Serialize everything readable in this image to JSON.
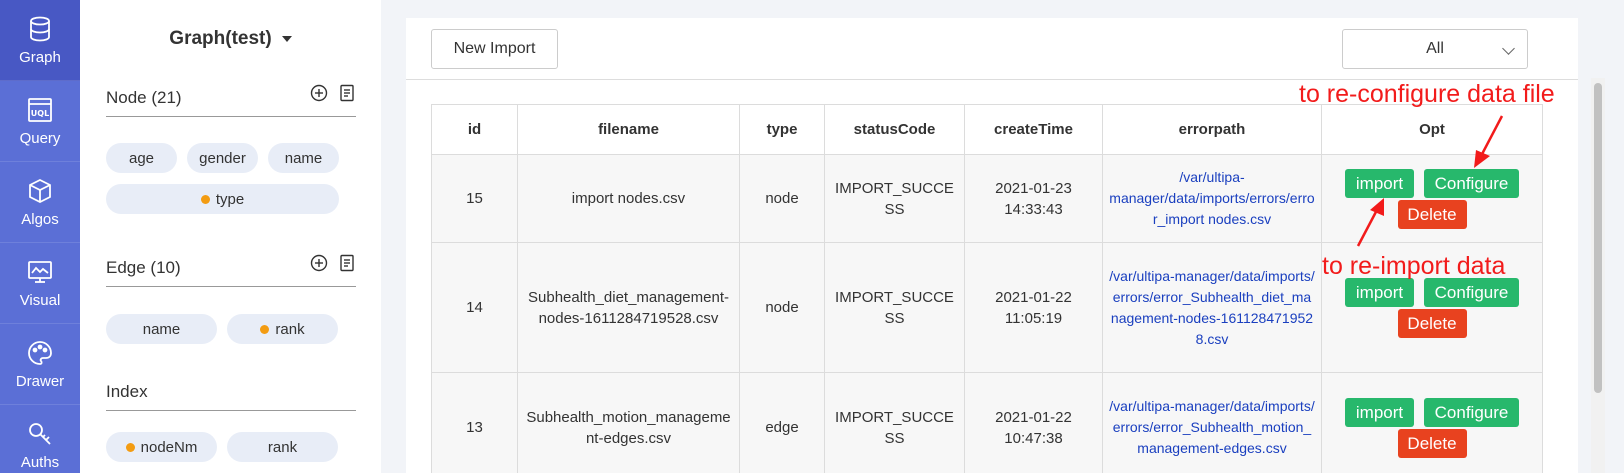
{
  "nav": [
    {
      "label": "Graph",
      "icon": "database-icon",
      "active": true
    },
    {
      "label": "Query",
      "icon": "uql-icon"
    },
    {
      "label": "Algos",
      "icon": "cube-icon"
    },
    {
      "label": "Visual",
      "icon": "monitor-icon"
    },
    {
      "label": "Drawer",
      "icon": "palette-icon"
    },
    {
      "label": "Auths",
      "icon": "key-icon"
    }
  ],
  "schema": {
    "graph_name": "Graph(test)",
    "node_title": "Node (21)",
    "node_props": [
      "age",
      "gender",
      "name",
      "type"
    ],
    "edge_title": "Edge (10)",
    "edge_props": [
      "name",
      "rank"
    ],
    "index_title": "Index",
    "index_props": [
      "nodeNm",
      "rank"
    ]
  },
  "toolbar": {
    "new_import": "New Import",
    "filter_value": "All"
  },
  "table": {
    "headers": [
      "id",
      "filename",
      "type",
      "statusCode",
      "createTime",
      "errorpath",
      "Opt"
    ],
    "rows": [
      {
        "id": "15",
        "filename": "import nodes.csv",
        "type": "node",
        "status": "IMPORT_SUCCESS",
        "time": "2021-01-23 14:33:43",
        "errorpath": "/var/ultipa-manager/data/imports/errors/error_import nodes.csv"
      },
      {
        "id": "14",
        "filename": "Subhealth_diet_management-nodes-1611284719528.csv",
        "type": "node",
        "status": "IMPORT_SUCCESS",
        "time": "2021-01-22 11:05:19",
        "errorpath": "/var/ultipa-manager/data/imports/errors/error_Subhealth_diet_management-nodes-1611284719528.csv"
      },
      {
        "id": "13",
        "filename": "Subhealth_motion_management-edges.csv",
        "type": "edge",
        "status": "IMPORT_SUCCESS",
        "time": "2021-01-22 10:47:38",
        "errorpath": "/var/ultipa-manager/data/imports/errors/error_Subhealth_motion_management-edges.csv"
      }
    ],
    "buttons": {
      "import": "import",
      "configure": "Configure",
      "delete": "Delete"
    }
  },
  "annotations": {
    "configure_note": "to re-configure data file",
    "import_note": "to re-import data"
  }
}
